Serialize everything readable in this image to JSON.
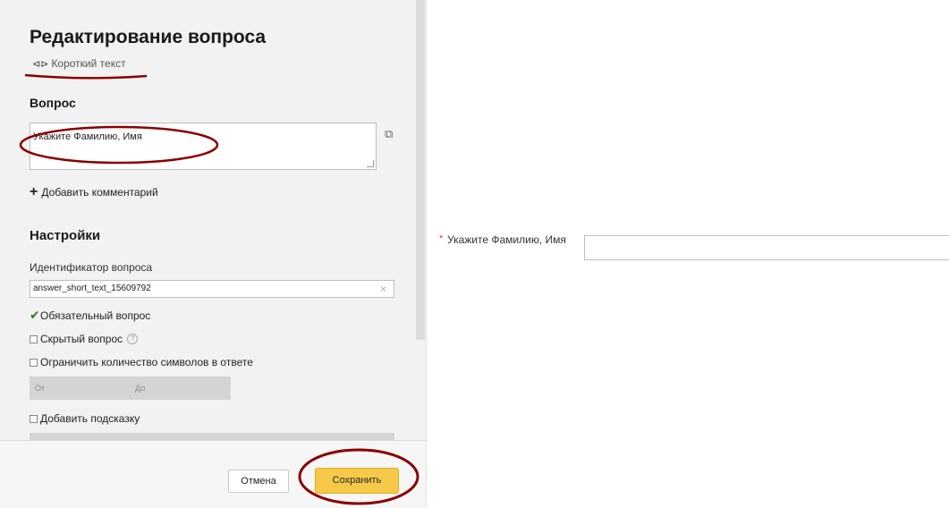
{
  "editor": {
    "title": "Редактирование вопроса",
    "type_icon": "short-text-icon",
    "type_label": "Короткий текст",
    "question_heading": "Вопрос",
    "question_text": "Укажите Фамилию, Имя",
    "add_comment": "Добавить комментарий",
    "settings_heading": "Настройки",
    "id_label": "Идентификатор вопроса",
    "id_value": "answer_short_text_15609792",
    "required_label": "Обязательный вопрос",
    "required_checked": true,
    "hidden_label": "Скрытый вопрос",
    "limit_label": "Ограничить количество символов в ответе",
    "from_placeholder": "От",
    "to_placeholder": "До",
    "hint_label": "Добавить подсказку"
  },
  "footer": {
    "cancel_label": "Отмена",
    "save_label": "Сохранить"
  },
  "preview": {
    "required_mark": "*",
    "label": "Укажите Фамилию, Имя"
  },
  "colors": {
    "annotation": "#8b0000",
    "save_button": "#f7c948",
    "required_star": "#e53935"
  }
}
